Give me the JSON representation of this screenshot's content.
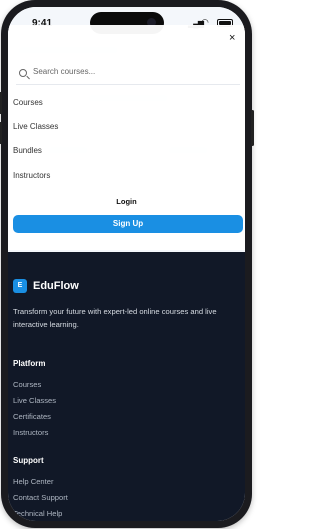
{
  "status_bar": {
    "time": "9:41"
  },
  "menu": {
    "search_placeholder": "Search courses...",
    "nav_items": [
      "Courses",
      "Live Classes",
      "Bundles",
      "Instructors"
    ],
    "login_label": "Login",
    "signup_label": "Sign Up",
    "close_label": "×"
  },
  "footer": {
    "logo_letter": "E",
    "brand_name": "EduFlow",
    "tagline": "Transform your future with expert-led online courses and live interactive learning.",
    "platform_title": "Platform",
    "platform_links": [
      "Courses",
      "Live Classes",
      "Certificates",
      "Instructors"
    ],
    "support_title": "Support",
    "support_links": [
      "Help Center",
      "Contact Support",
      "Technical Help"
    ]
  },
  "colors": {
    "accent": "#1a8fe3",
    "footer_bg": "#111827"
  }
}
